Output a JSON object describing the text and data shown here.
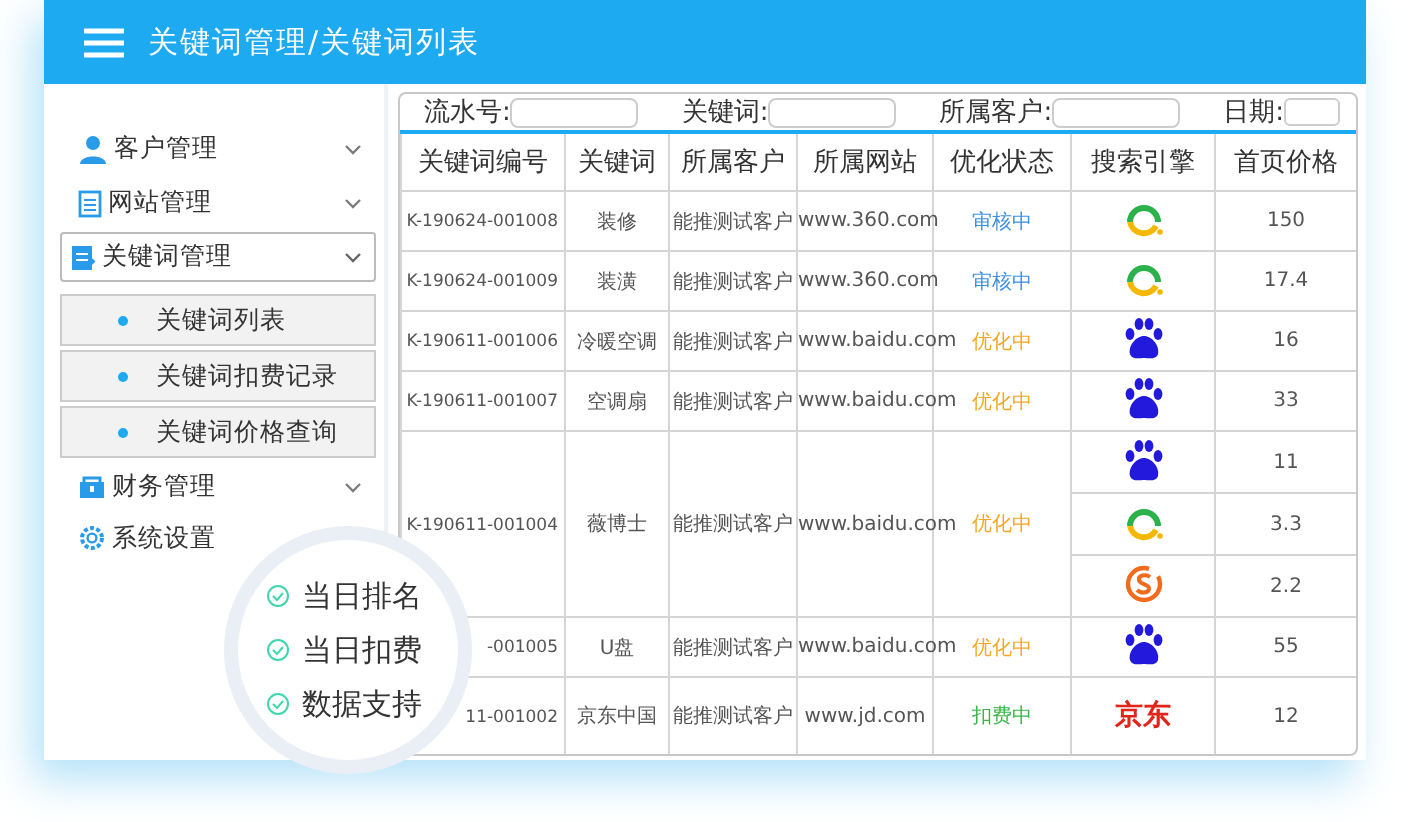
{
  "header": {
    "title": "关键词管理/关键词列表"
  },
  "sidebar": {
    "items": [
      {
        "label": "客户管理",
        "expanded": false
      },
      {
        "label": "网站管理",
        "expanded": false
      },
      {
        "label": "关键词管理",
        "expanded": true,
        "children": [
          {
            "label": "关键词列表"
          },
          {
            "label": "关键词扣费记录"
          },
          {
            "label": "关键词价格查询"
          }
        ]
      },
      {
        "label": "财务管理",
        "expanded": false
      },
      {
        "label": "系统设置"
      }
    ]
  },
  "filters": [
    {
      "label": "流水号:"
    },
    {
      "label": "关键词:"
    },
    {
      "label": "所属客户:"
    },
    {
      "label": "日期:",
      "kind": "date"
    }
  ],
  "table": {
    "columns": [
      "关键词编号",
      "关键词",
      "所属客户",
      "所属网站",
      "优化状态",
      "搜索引擎",
      "首页价格"
    ],
    "rows": [
      {
        "id": "K-190624-001008",
        "keyword": "装修",
        "client": "能推测试客户",
        "site": "www.360.com",
        "status": {
          "text": "审核中",
          "color": "#3d8fe0"
        },
        "engines": [
          {
            "kind": "qihoo",
            "price": "150"
          }
        ]
      },
      {
        "id": "K-190624-001009",
        "keyword": "装潢",
        "client": "能推测试客户",
        "site": "www.360.com",
        "status": {
          "text": "审核中",
          "color": "#3d8fe0"
        },
        "engines": [
          {
            "kind": "qihoo",
            "price": "17.4"
          }
        ]
      },
      {
        "id": "K-190611-001006",
        "keyword": "冷暖空调",
        "client": "能推测试客户",
        "site": "www.baidu.com",
        "status": {
          "text": "优化中",
          "color": "#f5a623"
        },
        "engines": [
          {
            "kind": "baidu",
            "price": "16"
          }
        ]
      },
      {
        "id": "K-190611-001007",
        "keyword": "空调扇",
        "client": "能推测试客户",
        "site": "www.baidu.com",
        "status": {
          "text": "优化中",
          "color": "#f5a623"
        },
        "engines": [
          {
            "kind": "baidu",
            "price": "33"
          }
        ]
      },
      {
        "id": "K-190611-001004",
        "keyword": "薇博士",
        "client": "能推测试客户",
        "site": "www.baidu.com",
        "status": {
          "text": "优化中",
          "color": "#f5a623"
        },
        "engines": [
          {
            "kind": "baidu",
            "price": "11"
          },
          {
            "kind": "qihoo",
            "price": "3.3"
          },
          {
            "kind": "sogou",
            "price": "2.2"
          }
        ]
      },
      {
        "id": "-001005",
        "keyword": "U盘",
        "client": "能推测试客户",
        "site": "www.baidu.com",
        "status": {
          "text": "优化中",
          "color": "#f5a623"
        },
        "engines": [
          {
            "kind": "baidu",
            "price": "55"
          }
        ]
      },
      {
        "id": "11-001002",
        "keyword": "京东中国",
        "client": "能推测试客户",
        "site": "www.jd.com",
        "status": {
          "text": "扣费中",
          "color": "#3bb54a"
        },
        "engines": [
          {
            "kind": "jd",
            "label": "京东",
            "price": "12"
          }
        ]
      }
    ]
  },
  "features": [
    "当日排名",
    "当日扣费",
    "数据支持"
  ]
}
